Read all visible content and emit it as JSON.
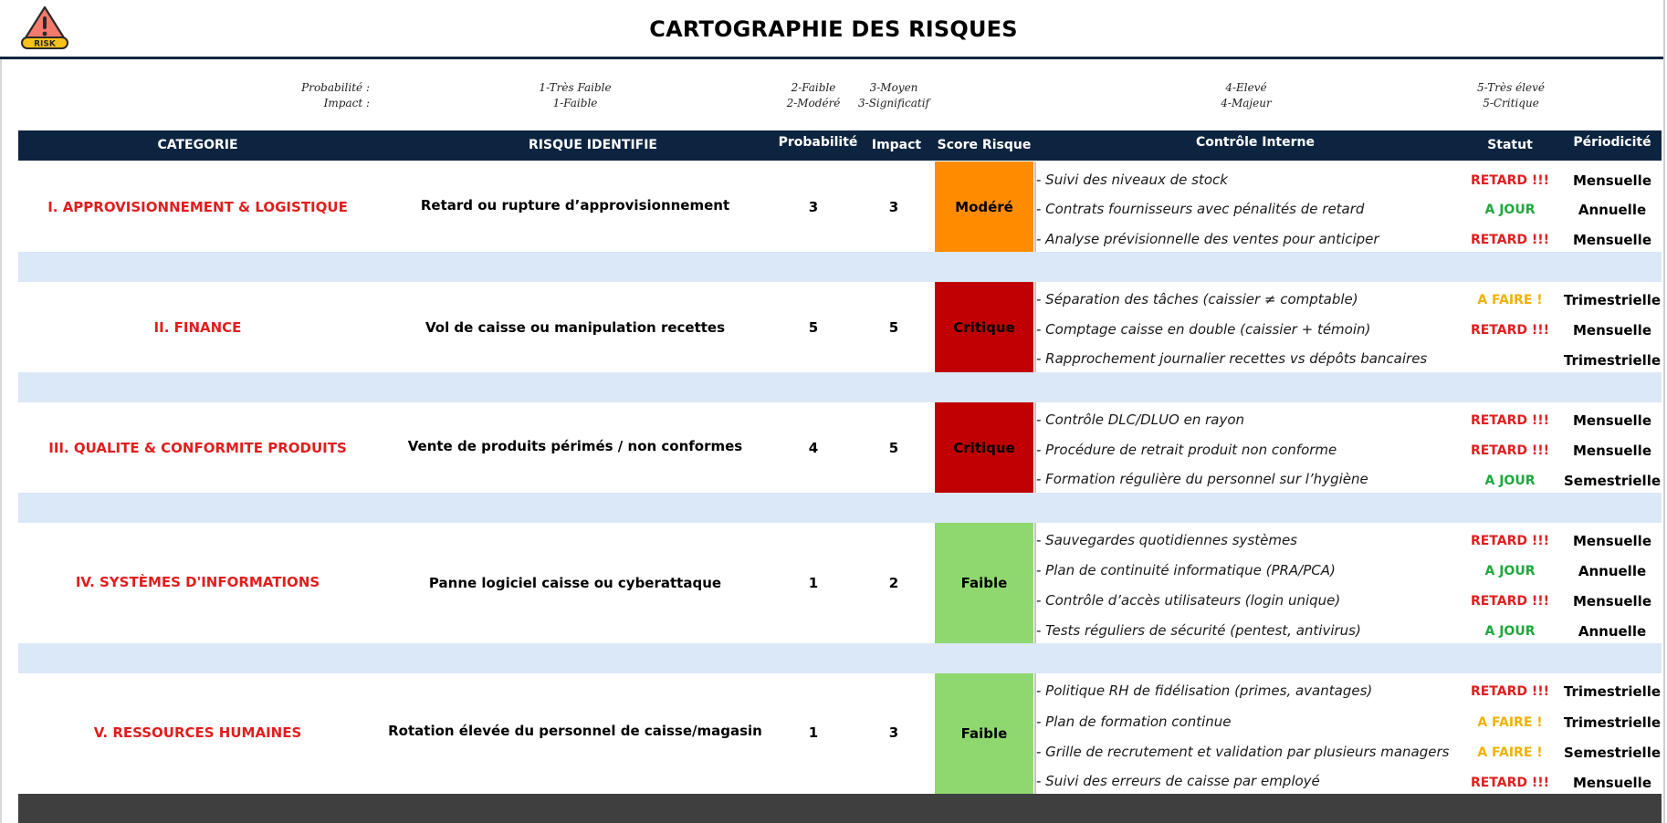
{
  "header": {
    "title": "CARTOGRAPHIE DES RISQUES",
    "logo_text": "RISK"
  },
  "legend": {
    "prob_label": "Probabilité :",
    "impact_label": "Impact :",
    "levels": [
      {
        "prob": "1-Très Faible",
        "impact": "1-Faible"
      },
      {
        "prob": "2-Faible",
        "impact": "2-Modéré"
      },
      {
        "prob": "3-Moyen",
        "impact": "3-Significatif"
      },
      {
        "prob": "4-Elevé",
        "impact": "4-Majeur"
      },
      {
        "prob": "5-Très élevé",
        "impact": "5-Critique"
      }
    ]
  },
  "columns": [
    "CATEGORIE",
    "RISQUE IDENTIFIE",
    "Probabilité",
    "Impact",
    "Score Risque",
    "Contrôle Interne",
    "Statut",
    "Périodicité"
  ],
  "colors": {
    "header_bg": "#0d2440",
    "category_text": "#e01e1e",
    "separator": "#dae8f7",
    "score_modere": "#ff8c00",
    "score_critique": "#c00000",
    "score_faible": "#8fd870",
    "status_retard": "#e01e1e",
    "status_a_jour": "#1fa83d",
    "status_a_faire": "#f2b100"
  },
  "rows": [
    {
      "category": "I. APPROVISIONNEMENT & LOGISTIQUE",
      "risk": "Retard ou rupture d’approvisionnement",
      "probability": "3",
      "impact": "3",
      "score": "Modéré",
      "controls": [
        {
          "text": "- Suivi des niveaux de stock",
          "status": "RETARD !!!",
          "period": "Mensuelle"
        },
        {
          "text": "- Contrats fournisseurs avec pénalités de retard",
          "status": "A JOUR",
          "period": "Annuelle"
        },
        {
          "text": "- Analyse prévisionnelle des ventes pour anticiper",
          "status": "RETARD !!!",
          "period": "Mensuelle"
        }
      ]
    },
    {
      "category": "II. FINANCE",
      "risk": "Vol de caisse ou manipulation recettes",
      "probability": "5",
      "impact": "5",
      "score": "Critique",
      "controls": [
        {
          "text": "- Séparation des tâches (caissier ≠ comptable)",
          "status": "A FAIRE !",
          "period": "Trimestrielle"
        },
        {
          "text": "- Comptage caisse en double (caissier + témoin)",
          "status": "RETARD !!!",
          "period": "Mensuelle"
        },
        {
          "text": "- Rapprochement journalier recettes vs dépôts bancaires",
          "status": "",
          "period": "Trimestrielle"
        }
      ]
    },
    {
      "category": "III. QUALITE & CONFORMITE PRODUITS",
      "risk": "Vente de produits périmés / non conformes",
      "probability": "4",
      "impact": "5",
      "score": "Critique",
      "controls": [
        {
          "text": "- Contrôle  DLC/DLUO en rayon",
          "status": "RETARD !!!",
          "period": "Mensuelle"
        },
        {
          "text": "- Procédure de retrait produit non conforme",
          "status": "RETARD !!!",
          "period": "Mensuelle"
        },
        {
          "text": "- Formation régulière du personnel sur l’hygiène",
          "status": "A JOUR",
          "period": "Semestrielle"
        }
      ]
    },
    {
      "category": "IV. SYSTÈMES D'INFORMATIONS",
      "risk": "Panne logiciel caisse ou cyberattaque",
      "probability": "1",
      "impact": "2",
      "score": "Faible",
      "controls": [
        {
          "text": "- Sauvegardes quotidiennes systèmes",
          "status": "RETARD !!!",
          "period": "Mensuelle"
        },
        {
          "text": "- Plan de continuité informatique (PRA/PCA)",
          "status": "A JOUR",
          "period": "Annuelle"
        },
        {
          "text": "- Contrôle d’accès utilisateurs (login unique)",
          "status": "RETARD !!!",
          "period": "Mensuelle"
        },
        {
          "text": "- Tests réguliers de sécurité (pentest, antivirus)",
          "status": "A JOUR",
          "period": "Annuelle"
        }
      ]
    },
    {
      "category": "V. RESSOURCES HUMAINES",
      "risk": "Rotation élevée du personnel de caisse/magasin",
      "probability": "1",
      "impact": "3",
      "score": "Faible",
      "controls": [
        {
          "text": "- Politique RH de fidélisation (primes, avantages)",
          "status": "RETARD !!!",
          "period": "Trimestrielle"
        },
        {
          "text": "- Plan de formation continue",
          "status": "A FAIRE !",
          "period": "Trimestrielle"
        },
        {
          "text": "- Grille de recrutement et validation par plusieurs managers",
          "status": "A FAIRE !",
          "period": "Semestrielle"
        },
        {
          "text": "- Suivi des erreurs de caisse par employé",
          "status": "RETARD !!!",
          "period": "Mensuelle"
        }
      ]
    }
  ]
}
